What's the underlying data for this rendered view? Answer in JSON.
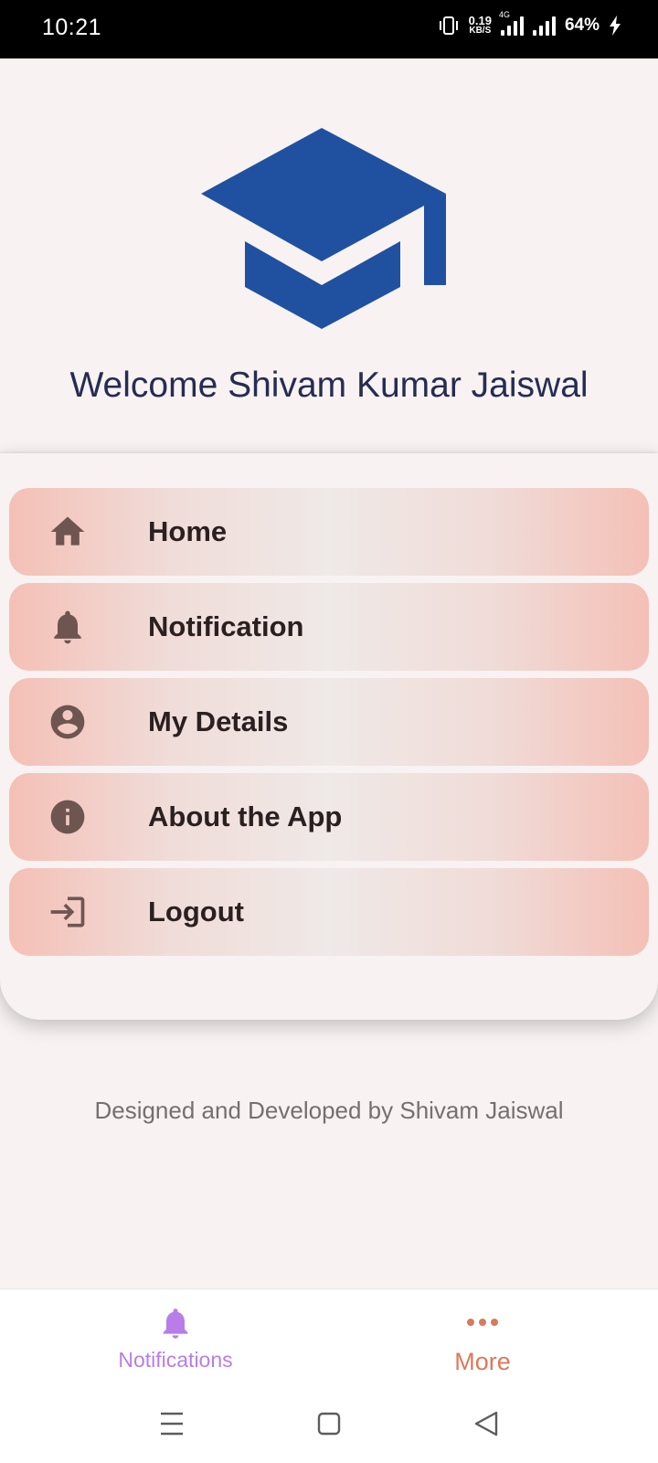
{
  "status_bar": {
    "time": "10:21",
    "net_speed_value": "0.19",
    "net_speed_unit": "KB/S",
    "network_type": "4G",
    "battery": "64%"
  },
  "header": {
    "logo_icon": "graduation-cap-icon",
    "logo_color": "#2051a0",
    "welcome_text": "Welcome Shivam Kumar Jaiswal"
  },
  "menu": {
    "items": [
      {
        "label": "Home",
        "icon": "home-icon"
      },
      {
        "label": "Notification",
        "icon": "bell-icon"
      },
      {
        "label": "My Details",
        "icon": "account-circle-icon"
      },
      {
        "label": "About the App",
        "icon": "info-icon"
      },
      {
        "label": "Logout",
        "icon": "logout-icon"
      }
    ],
    "icon_color": "#6e5550"
  },
  "footer": {
    "credit": "Designed and Developed by Shivam Jaiswal"
  },
  "bottom_nav": {
    "tabs": [
      {
        "label": "Notifications",
        "icon": "bell-icon",
        "color": "#b87de8"
      },
      {
        "label": "More",
        "icon": "more-horizontal-icon",
        "color": "#d97a5c"
      }
    ]
  },
  "system_nav": {
    "buttons": [
      "menu-icon",
      "home-square-icon",
      "back-triangle-icon"
    ]
  }
}
